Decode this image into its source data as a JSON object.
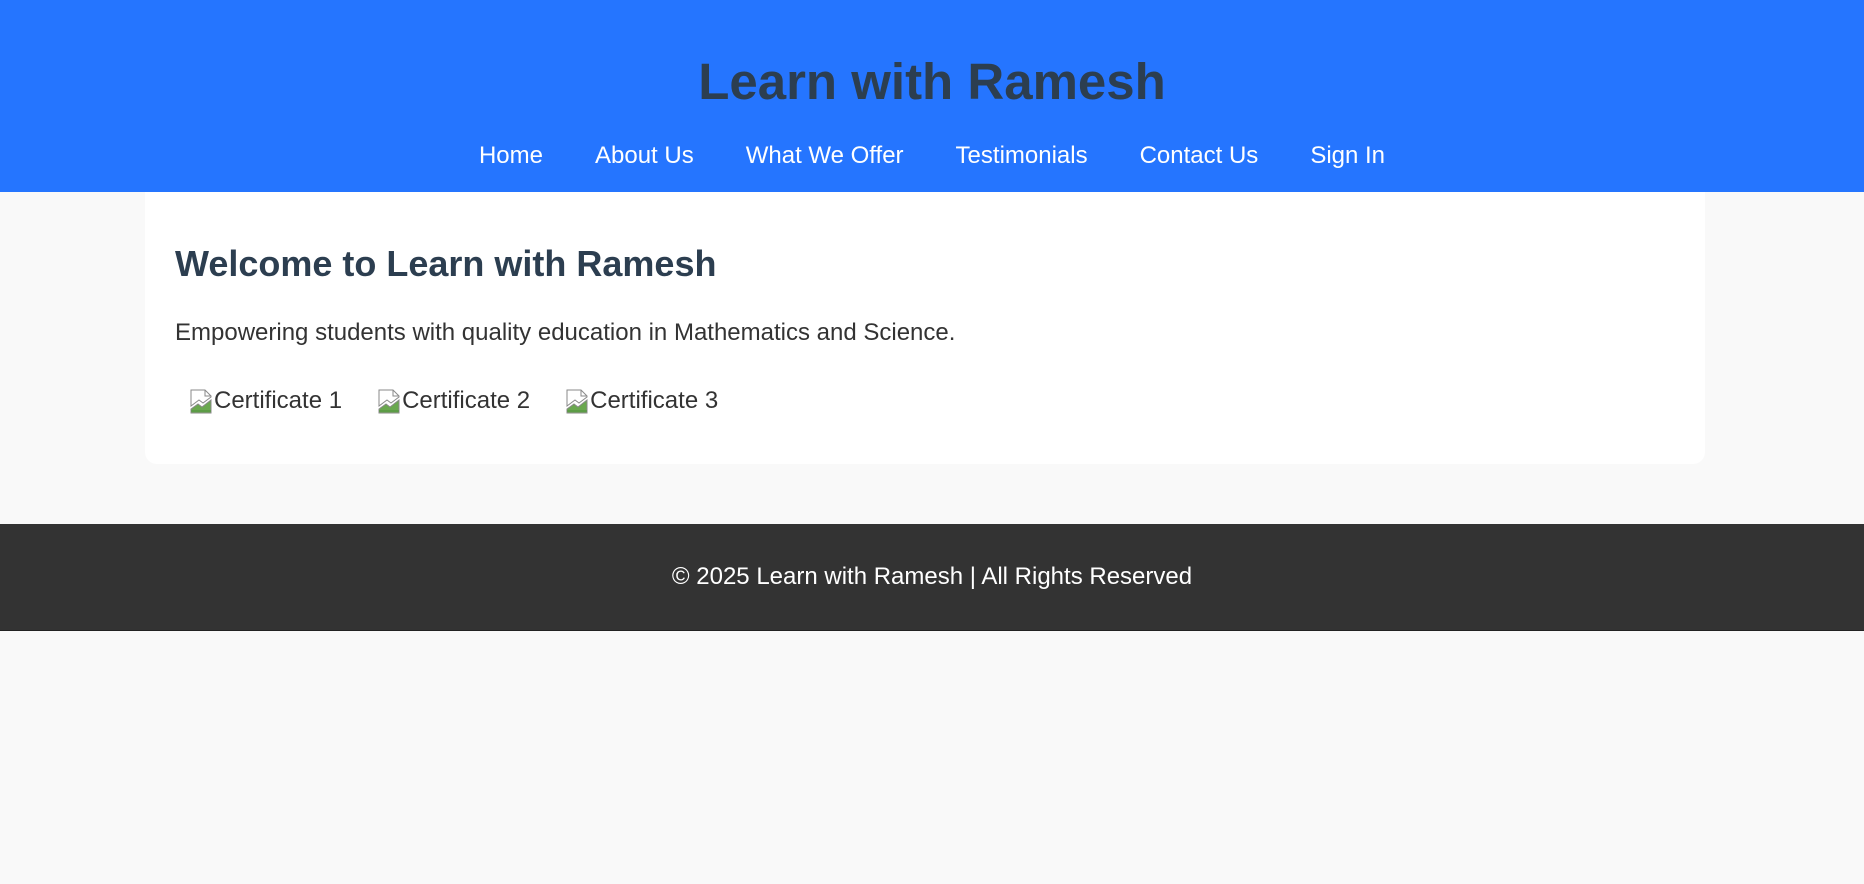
{
  "header": {
    "title": "Learn with Ramesh",
    "nav": [
      {
        "label": "Home"
      },
      {
        "label": "About Us"
      },
      {
        "label": "What We Offer"
      },
      {
        "label": "Testimonials"
      },
      {
        "label": "Contact Us"
      },
      {
        "label": "Sign In"
      }
    ]
  },
  "main": {
    "heading": "Welcome to Learn with Ramesh",
    "intro": "Empowering students with quality education in Mathematics and Science.",
    "certificates": [
      {
        "alt": "Certificate 1",
        "icon": "broken-image-icon"
      },
      {
        "alt": "Certificate 2",
        "icon": "broken-image-icon"
      },
      {
        "alt": "Certificate 3",
        "icon": "broken-image-icon"
      }
    ]
  },
  "footer": {
    "text": "© 2025 Learn with Ramesh | All Rights Reserved"
  },
  "colors": {
    "header_bg": "#2575ff",
    "title_text": "#2c3e50",
    "nav_text": "#ffffff",
    "page_bg": "#f9f9f9",
    "card_bg": "#ffffff",
    "body_text": "#333333",
    "footer_bg": "#333333",
    "footer_text": "#ffffff"
  }
}
